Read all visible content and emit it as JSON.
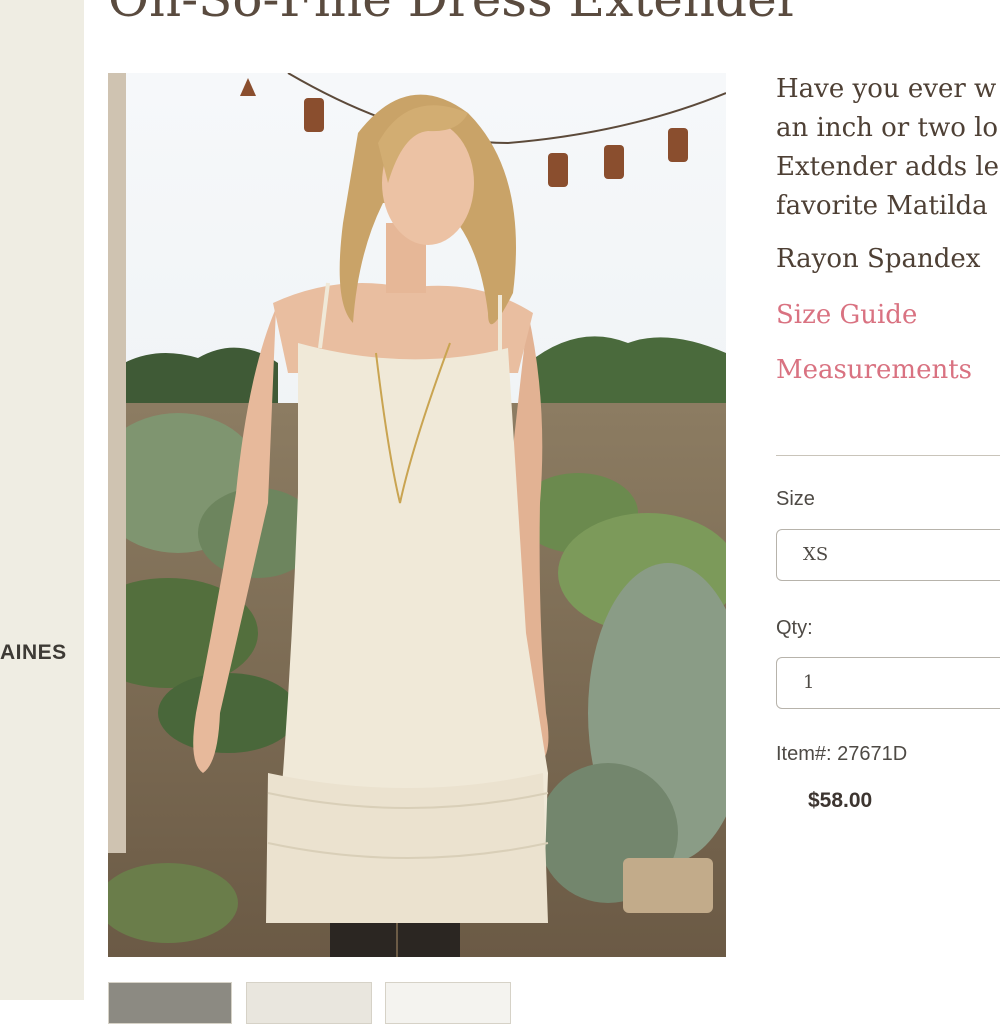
{
  "sidebar": {
    "link_label": "AINES"
  },
  "product": {
    "title": "Oh-So-Fine Dress Extender",
    "image_alt": "Model wearing cream dress extender outdoors",
    "description_lines": [
      "Have you ever w",
      "an inch or two lo",
      "Extender adds le",
      "favorite Matilda"
    ],
    "material": "Rayon Spandex",
    "size_guide_label": "Size Guide",
    "measurements_label": "Measurements",
    "size_label": "Size",
    "size_value": "XS",
    "qty_label": "Qty:",
    "qty_value": "1",
    "item_number": "Item#: 27671D",
    "price": "$58.00"
  },
  "colors": {
    "link": "#d97281",
    "sidebar_bg": "#efede3",
    "title": "#5a4b3f"
  }
}
